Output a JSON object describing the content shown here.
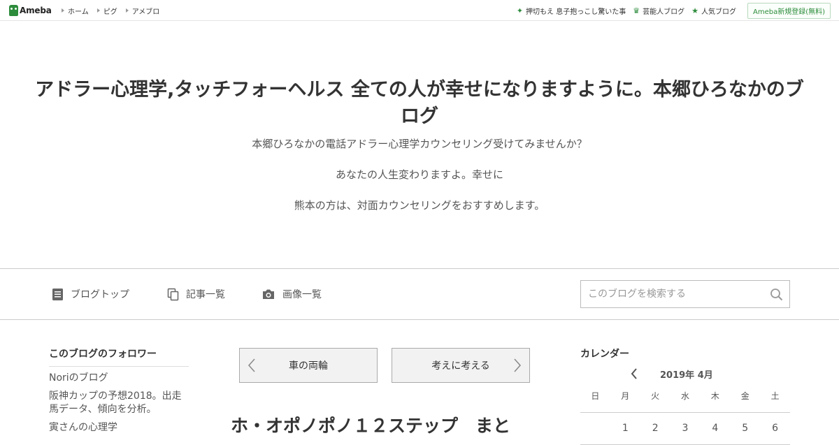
{
  "topbar": {
    "logo_text": "Ameba",
    "nav": [
      "ホーム",
      "ピグ",
      "アメブロ"
    ],
    "links": [
      {
        "icon": "sparkle-icon",
        "label": "押切もえ 息子抱っこし驚いた事"
      },
      {
        "icon": "crown-icon",
        "label": "芸能人ブログ"
      },
      {
        "icon": "crown-icon",
        "label": "人気ブログ"
      }
    ],
    "register_label": "Ameba新規登録(無料)",
    "accent_color": "#2d8c3c"
  },
  "header": {
    "title": "アドラー心理学,タッチフォーヘルス 全ての人が幸せになりますように。本郷ひろなかのブログ",
    "description": [
      "本郷ひろなかの電話アドラー心理学カウンセリング受けてみませんか？",
      "あなたの人生変わりますよ。幸せに",
      "熊本の方は、対面カウンセリングをおすすめします。"
    ]
  },
  "nav": {
    "blog_top": "ブログトップ",
    "article_list": "記事一覧",
    "image_list": "画像一覧",
    "search_placeholder": "このブログを検索する"
  },
  "sidebar": {
    "followers_heading": "このブログのフォロワー",
    "followers": [
      "Noriのブログ",
      "阪神カップの予想2018。出走馬データ、傾向を分析。",
      "寅さんの心理学"
    ]
  },
  "pager": {
    "prev_label": "車の両輪",
    "next_label": "考えに考える"
  },
  "entry": {
    "title": "ホ・オポノポノ１２ステップ　まと"
  },
  "calendar": {
    "heading": "カレンダー",
    "month": "2019年 4月",
    "weekdays": [
      "日",
      "月",
      "火",
      "水",
      "木",
      "金",
      "土"
    ],
    "first_week": [
      "",
      "1",
      "2",
      "3",
      "4",
      "5",
      "6"
    ]
  }
}
